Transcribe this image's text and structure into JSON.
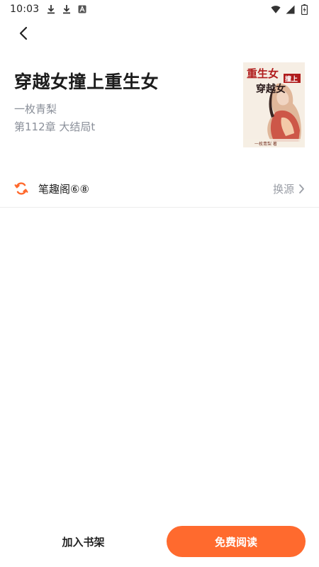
{
  "status_bar": {
    "time": "10:03",
    "icons_left": [
      "download-icon",
      "download-icon",
      "notification-a-icon"
    ],
    "icons_right": [
      "wifi-icon",
      "signal-icon",
      "battery-charging-icon"
    ]
  },
  "navigation": {
    "back_icon": "chevron-left-icon"
  },
  "book": {
    "title": "穿越女撞上重生女",
    "author": "一枚青梨",
    "latest_chapter": "第112章 大结局t",
    "cover": {
      "title_line1": "重生女",
      "badge": "撞上",
      "title_line2": "穿越女",
      "footer": "一枚青梨 著"
    }
  },
  "source": {
    "icon": "source-swap-icon",
    "name": "笔趣阁⑥⑧",
    "switch_label": "换源",
    "switch_icon": "chevron-right-icon"
  },
  "actions": {
    "add_to_shelf": "加入书架",
    "read_free": "免费阅读"
  },
  "colors": {
    "accent": "#ff6a2e",
    "muted_text": "#8a8f99"
  }
}
